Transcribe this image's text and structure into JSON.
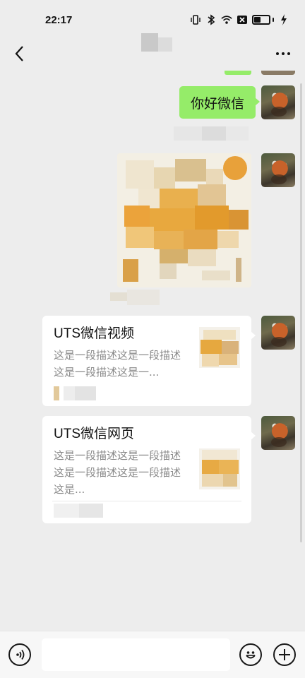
{
  "status_bar": {
    "time": "22:17"
  },
  "header": {
    "back_icon": "chevron-left-icon",
    "more_icon": "more-dots-icon"
  },
  "messages": [
    {
      "type": "text",
      "text": "你好微信"
    },
    {
      "type": "image"
    },
    {
      "type": "card",
      "title": "UTS微信视频",
      "description": "这是一段描述这是一段描述这是一段描述这是一..."
    },
    {
      "type": "card",
      "title": "UTS微信网页",
      "description": "这是一段描述这是一段描述这是一段描述这是一段描述这是..."
    }
  ],
  "input_bar": {
    "voice_icon": "voice-icon",
    "emoji_icon": "emoji-icon",
    "plus_icon": "plus-icon",
    "input_value": ""
  },
  "colors": {
    "background": "#ededed",
    "bubble_green": "#95ec69",
    "card_bg": "#ffffff",
    "secondary_text": "#8a8a8a"
  }
}
